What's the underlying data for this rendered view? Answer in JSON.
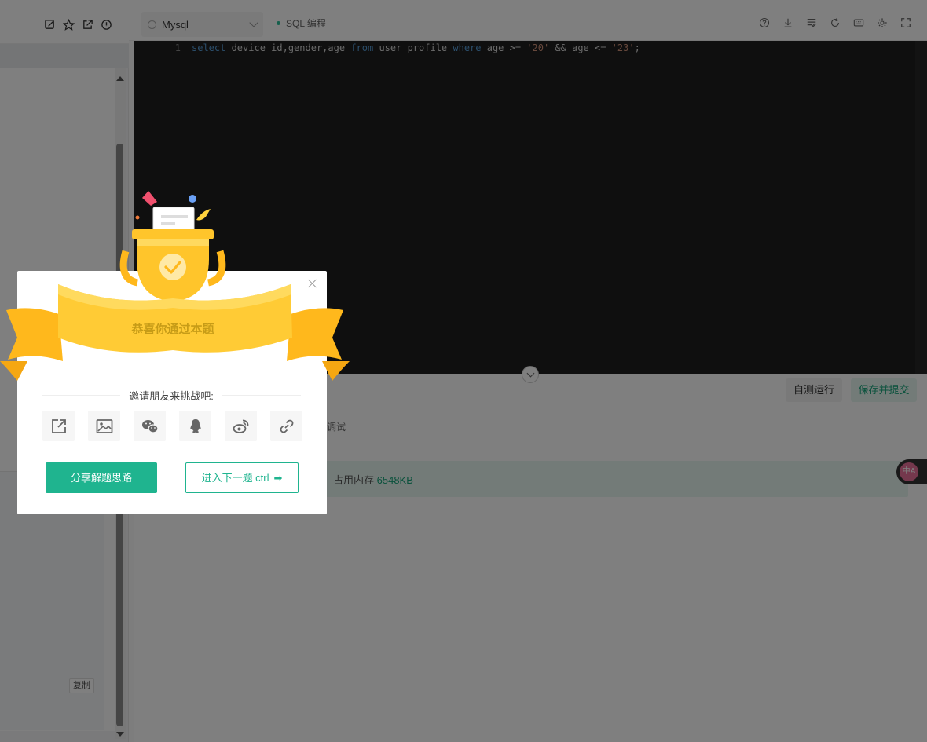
{
  "editor": {
    "language": "Mysql",
    "mode_label": "SQL 编程",
    "line_number": "1",
    "code": {
      "t1": "select",
      "t2": " device_id,gender,age ",
      "t3": "from",
      "t4": " user_profile ",
      "t5": "where",
      "t6": " age >= ",
      "t7": "'20'",
      "t8": " && age <= ",
      "t9": "'23'",
      "t10": ";"
    }
  },
  "left_panel": {
    "copy_label": "复制"
  },
  "actions": {
    "run_label": "自测运行",
    "submit_label": "保存并提交"
  },
  "bottom": {
    "debug_label": "调试",
    "memory_label": "占用内存",
    "memory_value": "6548KB"
  },
  "translate": {
    "label": "中A"
  },
  "modal": {
    "banner_text": "恭喜你通过本题",
    "invite_text": "邀请朋友来挑战吧:",
    "share_icons": [
      "external-link-icon",
      "image-icon",
      "wechat-icon",
      "qq-icon",
      "weibo-icon",
      "link-icon"
    ],
    "share_button": "分享解题思路",
    "next_button": "进入下一题 ctrl",
    "next_arrow": "➡"
  },
  "colors": {
    "accent": "#1fb48f",
    "banner_gold": "#ffc72c",
    "editor_bg": "#1e1e1e"
  }
}
